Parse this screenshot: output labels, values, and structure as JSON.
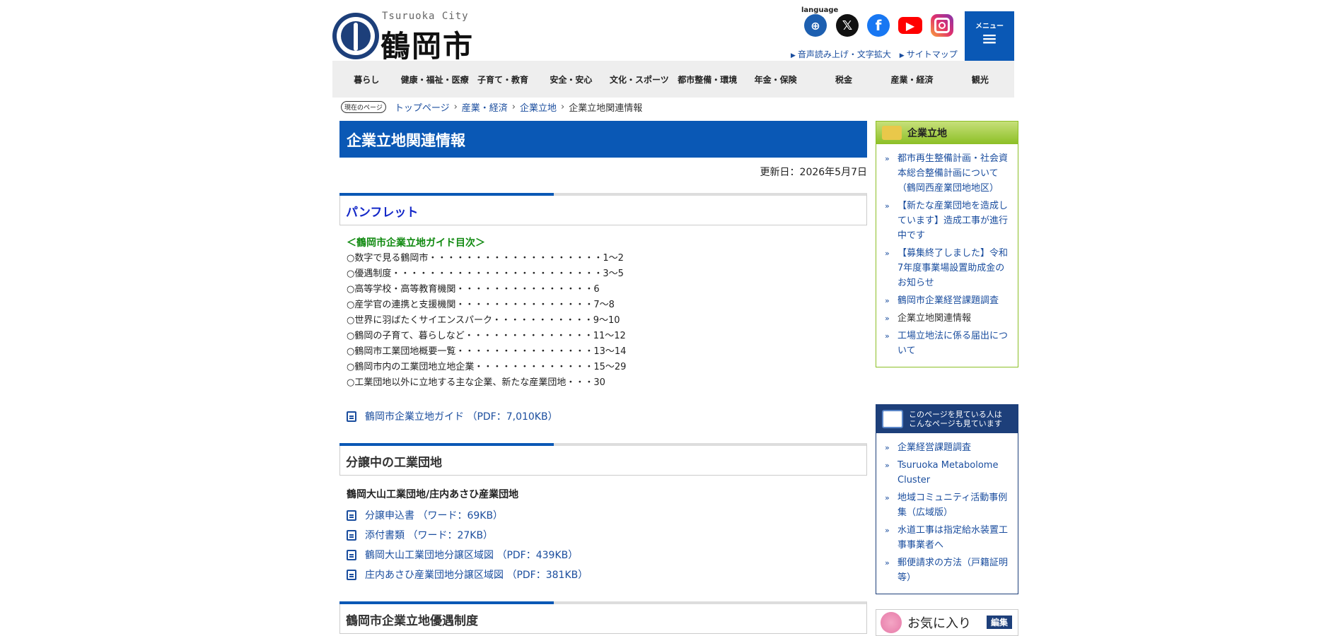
{
  "header": {
    "logo_en": "Tsuruoka City",
    "logo_jp": "鶴岡市",
    "language_label": "language",
    "social_icons": [
      "globe-icon",
      "x-icon",
      "facebook-icon",
      "youtube-icon",
      "instagram-icon"
    ],
    "top_links": [
      "音声読み上げ・文字拡大",
      "サイトマップ"
    ],
    "menu_label": "メニュー",
    "menu_icon": "≡"
  },
  "nav": [
    "暮らし",
    "健康・福祉・医療",
    "子育て・教育",
    "安全・安心",
    "文化・スポーツ",
    "都市整備・環境",
    "年金・保険",
    "税金",
    "産業・経済",
    "観光"
  ],
  "breadcrumb": {
    "here_label": "現在のページ",
    "items": [
      "トップページ",
      "産業・経済",
      "企業立地"
    ],
    "separator": "›",
    "current": "企業立地関連情報"
  },
  "main": {
    "title": "企業立地関連情報",
    "updated": "更新日：2026年5月7日",
    "section1": {
      "heading": "パンフレット",
      "toc_title": "＜鶴岡市企業立地ガイド目次＞",
      "toc": [
        "○数字で見る鶴岡市・・・・・・・・・・・・・・・・・・・1～2",
        "○優遇制度・・・・・・・・・・・・・・・・・・・・・・・3～5",
        "○高等学校・高等教育機関・・・・・・・・・・・・・・・6",
        "○産学官の連携と支援機関・・・・・・・・・・・・・・・7～8",
        "○世界に羽ばたくサイエンスパーク・・・・・・・・・・・9～10",
        "○鶴岡の子育て、暮らしなど・・・・・・・・・・・・・・11～12",
        "○鶴岡市工業団地概要一覧・・・・・・・・・・・・・・・13～14",
        "○鶴岡市内の工業団地立地企業・・・・・・・・・・・・・15～29",
        "○工業団地以外に立地する主な企業、新たな産業団地・・・30"
      ],
      "pdf": "鶴岡市企業立地ガイド （PDF：7,010KB）"
    },
    "section2": {
      "heading": "分譲中の工業団地",
      "subheading": "鶴岡大山工業団地/庄内あさひ産業団地",
      "files": [
        "分譲申込書 （ワード：69KB）",
        "添付書類 （ワード：27KB）",
        "鶴岡大山工業団地分譲区域図 （PDF：439KB）",
        "庄内あさひ産業団地分譲区域図 （PDF：381KB）"
      ]
    },
    "section3": {
      "heading": "鶴岡市企業立地優遇制度"
    }
  },
  "sidebar": {
    "box1": {
      "title": "企業立地",
      "items": [
        "都市再生整備計画・社会資本総合整備計画について（鶴岡西産業団地地区）",
        "【新たな産業団地を造成しています】造成工事が進行中です",
        "【募集終了しました】令和7年度事業場設置助成金のお知らせ",
        "鶴岡市企業経営課題調査",
        "企業立地関連情報",
        "工場立地法に係る届出について"
      ]
    },
    "box2": {
      "title_line1": "このページを見ている人は",
      "title_line2": "こんなページも見ています",
      "items": [
        "企業経営課題調査",
        "Tsuruoka Metabolome Cluster",
        "地域コミュニティ活動事例集（広域版）",
        "水道工事は指定給水装置工事事業者へ",
        "郵便請求の方法（戸籍証明等）"
      ]
    },
    "favorites": {
      "title": "お気に入り",
      "edit": "編集"
    }
  }
}
